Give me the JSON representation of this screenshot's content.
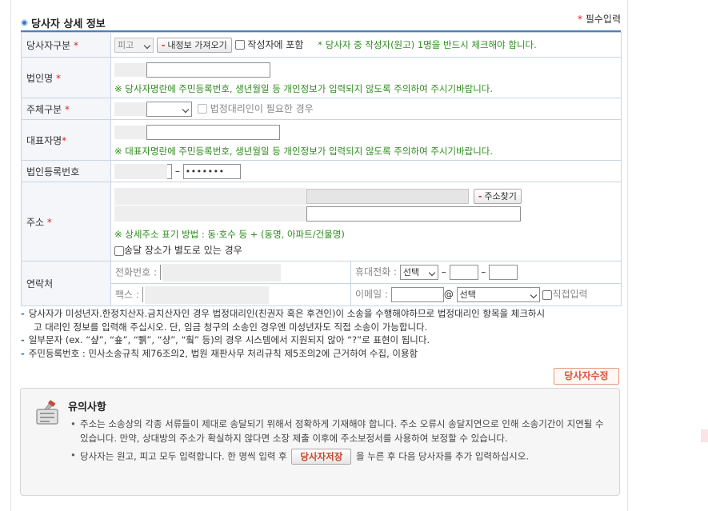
{
  "section": {
    "title": "당사자 상세 정보",
    "required_mark": "*",
    "required_label": "필수입력"
  },
  "rows": {
    "party_type": {
      "label": "당사자구분",
      "mark": "*",
      "select_value": "피고",
      "load_button": "내정보 가져오기",
      "include_writer": "작성자에 포함",
      "notice_mark": "*",
      "notice": "당사자 중 작성자(원고) 1명을 반드시 체크해야 합니다."
    },
    "corp_name": {
      "label": "법인명",
      "mark": "*",
      "notice": "※ 당사자명란에 주민등록번호, 생년월일 등 개인정보가 입력되지 않도록 주의하여 주시기바랍니다."
    },
    "subject_type": {
      "label": "주체구분",
      "mark": "*",
      "legal_rep": "법정대리인이 필요한 경우"
    },
    "representative": {
      "label": "대표자명",
      "mark": "*",
      "notice": "※ 대표자명란에 주민등록번호, 생년월일 등 개인정보가 입력되지 않도록 주의하여 주시기바랍니다."
    },
    "corp_reg": {
      "label": "법인등록번호",
      "dash": "–",
      "back_value": "•••••••"
    },
    "address": {
      "label": "주소",
      "mark": "*",
      "find_button": "주소찾기",
      "notice": "※ 상세주소 표기 방법 : 동·호수 등 + (동명, 아파트/건물명)",
      "delivery_label": "송달 장소가 별도로 있는 경우"
    },
    "contact": {
      "label": "연락처",
      "phone_label": "전화번호 :",
      "fax_label": "팩스 :",
      "mobile_label": "휴대전화 :",
      "mobile_select": "선택",
      "dash1": "–",
      "dash2": "–",
      "email_label": "이메일 :",
      "at": "@",
      "email_select": "선택",
      "direct_input": "직접입력"
    }
  },
  "notes": [
    "당사자가 미성년자.한정치산자.금치산자인 경우 법정대리인(친권자 혹은 후견인)이 소송을 수행해야하므로 법정대리인 항목을 체크하시",
    "고 대리인 정보를 입력해 주십시오. 단, 임금 청구의 소송인 경우엔 미성년자도 직접 소송이 가능합니다.",
    "일부문자 (ex. “샾”, “숖”, “쀍”, “샹”, “훸” 등)의 경우 시스템에서 지원되지 않아 “?”로 표현이 됩니다.",
    "주민등록번호 : 민사소송규칙 제76조의2, 법원 재판사무 처리규칙 제5조의2에 근거하여 수집, 이용함"
  ],
  "buttons": {
    "edit": "당사자수정"
  },
  "caution": {
    "title": "유의사항",
    "items": [
      "주소는 소송상의 각종 서류들이 제대로 송달되기 위해서 정확하게 기재해야 합니다. 주소 오류시 송달지연으로 인해 소송기간이 지연될 수 있습니다. 만약, 상대방의 주소가 확실하지 않다면 소장 제출 이후에 주소보정서를 사용하여 보정할 수 있습니다.",
      {
        "before": "당사자는 원고, 피고 모두 입력합니다. 한 명씩 입력 후 ",
        "button": "당사자저장",
        "after": " 을 누른 후 다음 당사자를 추가 입력하십시오."
      }
    ]
  }
}
